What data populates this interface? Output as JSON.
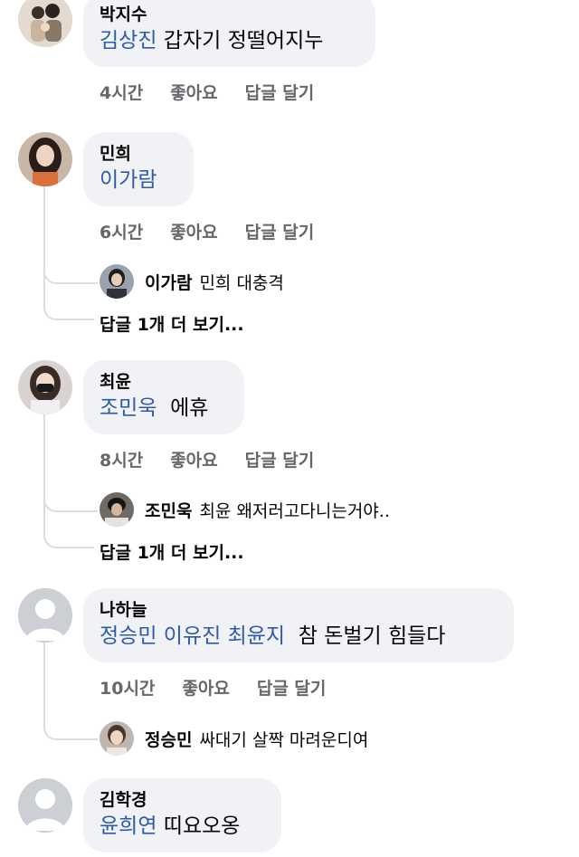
{
  "comments": [
    {
      "author": "박지수",
      "tags": [
        "김상진"
      ],
      "text": "갑자기 정떨어지누",
      "time": "4시간",
      "like_label": "좋아요",
      "reply_label": "답글 달기"
    },
    {
      "author": "민희",
      "tags": [
        "이가람"
      ],
      "text": "",
      "time": "6시간",
      "like_label": "좋아요",
      "reply_label": "답글 달기",
      "reply": {
        "author": "이가람",
        "text": "민희 대충격"
      },
      "more_label": "답글 1개 더 보기..."
    },
    {
      "author": "최윤",
      "tags": [
        "조민욱"
      ],
      "text": "에휴",
      "time": "8시간",
      "like_label": "좋아요",
      "reply_label": "답글 달기",
      "reply": {
        "author": "조민욱",
        "text": "최윤 왜저러고다니는거야.."
      },
      "more_label": "답글 1개 더 보기..."
    },
    {
      "author": "나하늘",
      "tags": [
        "정승민",
        "이유진",
        "최윤지"
      ],
      "text": "참 돈벌기 힘들다",
      "time": "10시간",
      "like_label": "좋아요",
      "reply_label": "답글 달기",
      "reply": {
        "author": "정승민",
        "text": "싸대기 살짝 마려운디여"
      }
    },
    {
      "author": "김학경",
      "tags": [
        "윤희연"
      ],
      "text": "띠요오옹"
    }
  ],
  "colors": {
    "tag": "#2e5ba8",
    "bubble": "#f0f2f5",
    "meta": "#65676b",
    "thread_line": "#dadde1"
  },
  "icons": {
    "default_avatar": "person-silhouette-icon"
  }
}
